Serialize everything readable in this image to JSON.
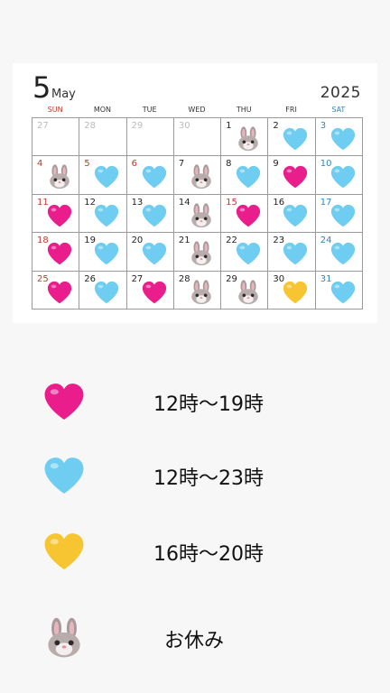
{
  "calendar": {
    "month_number": "5",
    "month_name": "May",
    "year": "2025",
    "weekdays": [
      "SUN",
      "MON",
      "TUE",
      "WED",
      "THU",
      "FRI",
      "SAT"
    ],
    "days": [
      {
        "day": "27",
        "type": "other",
        "mark": ""
      },
      {
        "day": "28",
        "type": "other",
        "mark": ""
      },
      {
        "day": "29",
        "type": "other",
        "mark": ""
      },
      {
        "day": "30",
        "type": "other",
        "mark": ""
      },
      {
        "day": "1",
        "type": "normal",
        "mark": "rabbit"
      },
      {
        "day": "2",
        "type": "normal",
        "mark": "blue"
      },
      {
        "day": "3",
        "type": "sat",
        "mark": "blue"
      },
      {
        "day": "4",
        "type": "sun",
        "mark": "rabbit"
      },
      {
        "day": "5",
        "type": "sun",
        "mark": "blue"
      },
      {
        "day": "6",
        "type": "sun",
        "mark": "blue"
      },
      {
        "day": "7",
        "type": "normal",
        "mark": "rabbit"
      },
      {
        "day": "8",
        "type": "normal",
        "mark": "blue"
      },
      {
        "day": "9",
        "type": "normal",
        "mark": "pink"
      },
      {
        "day": "10",
        "type": "sat",
        "mark": "blue"
      },
      {
        "day": "11",
        "type": "sun",
        "mark": "pink"
      },
      {
        "day": "12",
        "type": "normal",
        "mark": "blue"
      },
      {
        "day": "13",
        "type": "normal",
        "mark": "blue"
      },
      {
        "day": "14",
        "type": "normal",
        "mark": "rabbit"
      },
      {
        "day": "15",
        "type": "sun",
        "mark": "pink"
      },
      {
        "day": "16",
        "type": "normal",
        "mark": "blue"
      },
      {
        "day": "17",
        "type": "sat",
        "mark": "blue"
      },
      {
        "day": "18",
        "type": "sun",
        "mark": "pink"
      },
      {
        "day": "19",
        "type": "normal",
        "mark": "blue"
      },
      {
        "day": "20",
        "type": "normal",
        "mark": "blue"
      },
      {
        "day": "21",
        "type": "normal",
        "mark": "rabbit"
      },
      {
        "day": "22",
        "type": "normal",
        "mark": "blue"
      },
      {
        "day": "23",
        "type": "normal",
        "mark": "blue"
      },
      {
        "day": "24",
        "type": "sat",
        "mark": "blue"
      },
      {
        "day": "25",
        "type": "sun",
        "mark": "pink"
      },
      {
        "day": "26",
        "type": "normal",
        "mark": "blue"
      },
      {
        "day": "27",
        "type": "normal",
        "mark": "pink"
      },
      {
        "day": "28",
        "type": "normal",
        "mark": "rabbit"
      },
      {
        "day": "29",
        "type": "normal",
        "mark": "rabbit"
      },
      {
        "day": "30",
        "type": "normal",
        "mark": "yellow"
      },
      {
        "day": "31",
        "type": "sat",
        "mark": "blue"
      }
    ]
  },
  "legend": [
    {
      "icon": "pink-heart-icon",
      "mark": "pink",
      "label": "12時〜19時"
    },
    {
      "icon": "blue-heart-icon",
      "mark": "blue",
      "label": "12時〜23時"
    },
    {
      "icon": "yellow-heart-icon",
      "mark": "yellow",
      "label": "16時〜20時"
    },
    {
      "icon": "rabbit-face-icon",
      "mark": "rabbit",
      "label": "お休み"
    }
  ],
  "colors": {
    "pink": "#e91e8c",
    "blue": "#6fcdf2",
    "yellow": "#f7c531",
    "sunday": "#c0392b",
    "saturday": "#2e86c1"
  }
}
